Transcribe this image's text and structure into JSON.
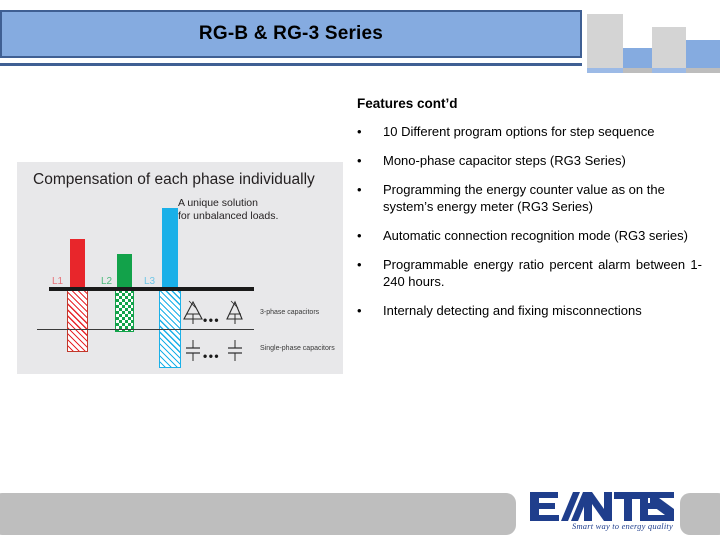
{
  "slide": {
    "title": "RG-B & RG-3 Series",
    "heading": "Features cont’d",
    "bullet_marker": "•"
  },
  "theme": {
    "title_bar_fill": "#85abe0",
    "title_bar_border": "#3f5f93",
    "deco_gray": "#d4d4d4",
    "deco_blue": "#85abe0",
    "panel_bg": "#e8e8ea",
    "footer_gray": "#bebebe",
    "logo_blue": "#1f3e8c",
    "phase_l1": "#e8262b",
    "phase_l2": "#12a24a",
    "phase_l3": "#1ab0e8"
  },
  "features": [
    "10 Different program options for step sequence",
    "Mono-phase capacitor steps (RG3 Series)",
    "Programming the energy counter value as on the system’s energy meter (RG3 Series)",
    "Automatic connection recognition mode (RG3 series)",
    "Programmable energy ratio percent alarm between 1-240 hours.",
    "Internaly detecting and fixing misconnections"
  ],
  "diagram": {
    "title": "Compensation of each phase individually",
    "note_line1": "A unique solution",
    "note_line2": "for unbalanced loads.",
    "phase_labels": {
      "l1": "L1",
      "l2": "L2",
      "l3": "L3"
    },
    "capacitor_rows": {
      "three_phase": "3-phase capacitors",
      "single_phase": "Single-phase capacitors"
    },
    "ellipsis": "•••"
  },
  "footer": {
    "logo_text": "ENTES",
    "logo_tagline": "Smart way to energy quality"
  }
}
